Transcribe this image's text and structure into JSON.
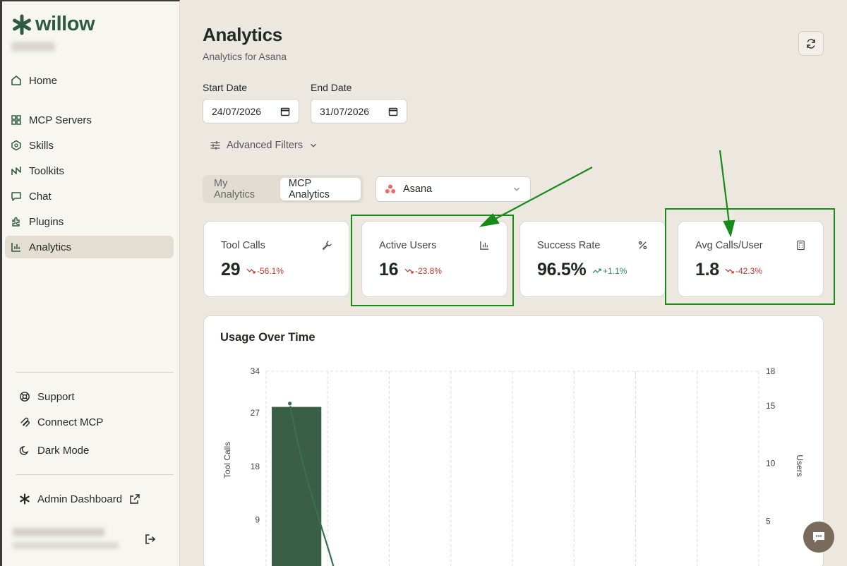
{
  "brand": {
    "name": "willow"
  },
  "nav": {
    "home": "Home",
    "mcp_servers": "MCP Servers",
    "skills": "Skills",
    "toolkits": "Toolkits",
    "chat": "Chat",
    "plugins": "Plugins",
    "analytics": "Analytics"
  },
  "footer": {
    "support": "Support",
    "connect_mcp": "Connect MCP",
    "dark_mode": "Dark Mode",
    "admin_dashboard": "Admin Dashboard"
  },
  "header": {
    "title": "Analytics",
    "subtitle": "Analytics for Asana"
  },
  "filters": {
    "start_label": "Start Date",
    "start_value": "24/07/2026",
    "end_label": "End Date",
    "end_value": "31/07/2026",
    "advanced": "Advanced Filters"
  },
  "tabs": {
    "my": "My Analytics",
    "mcp": "MCP Analytics"
  },
  "server_select": {
    "value": "Asana"
  },
  "cards": {
    "tool_calls": {
      "label": "Tool Calls",
      "value": "29",
      "delta": "-56.1%"
    },
    "active_users": {
      "label": "Active Users",
      "value": "16",
      "delta": "-23.8%"
    },
    "success_rate": {
      "label": "Success Rate",
      "value": "96.5%",
      "delta": "+1.1%"
    },
    "avg_calls": {
      "label": "Avg Calls/User",
      "value": "1.8",
      "delta": "-42.3%"
    }
  },
  "colors": {
    "accent": "#2f5a44",
    "bar": "#3b5e47",
    "negative": "#c0392b",
    "positive": "#2e8b57",
    "annotation": "#178a17"
  },
  "chart_data": {
    "type": "bar",
    "title": "Usage Over Time",
    "ylabel": "Tool Calls",
    "y2label": "Users",
    "ylim": [
      0,
      34
    ],
    "y2lim": [
      0,
      18
    ],
    "yticks": [
      "34",
      "27",
      "18",
      "9"
    ],
    "y2ticks": [
      "18",
      "15",
      "10",
      "5"
    ],
    "series": [
      {
        "name": "Tool Calls",
        "type": "bar",
        "values": [
          28
        ]
      },
      {
        "name": "Users",
        "type": "line",
        "values": [
          15.2,
          0
        ]
      }
    ]
  }
}
